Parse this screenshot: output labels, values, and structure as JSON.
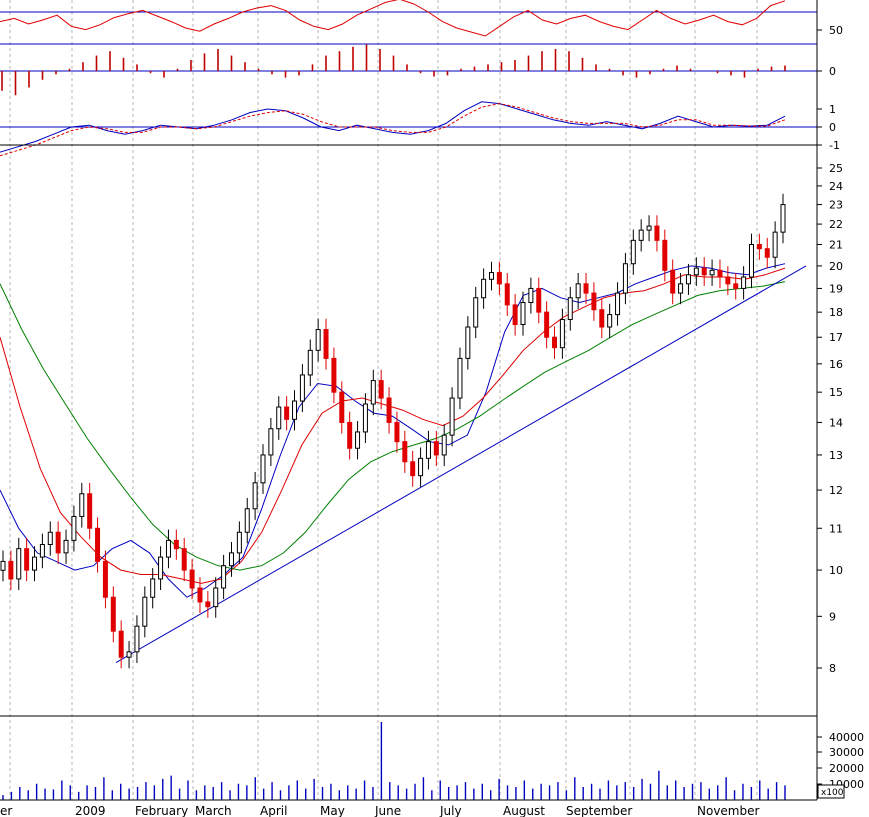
{
  "chart_data": [
    {
      "panel": "indicator-oscillator-top",
      "type": "line",
      "y_ticks": [
        "50"
      ],
      "series": [
        {
          "color": "#e00000",
          "values": [
            58,
            62,
            55,
            60,
            66,
            52,
            48,
            54,
            63,
            68,
            72,
            65,
            58,
            50,
            46,
            55,
            62,
            70,
            75,
            78,
            72,
            60,
            52,
            48,
            55,
            66,
            74,
            82,
            86,
            80,
            70,
            58,
            50,
            45,
            40,
            52,
            64,
            72,
            60,
            55,
            62,
            66,
            58,
            52,
            48,
            60,
            72,
            62,
            55,
            60,
            66,
            58,
            54,
            62,
            78,
            84
          ]
        }
      ],
      "reference_lines": [
        70,
        30
      ]
    },
    {
      "panel": "indicator-histogram",
      "type": "bar",
      "y_ticks": [
        "0"
      ],
      "series": [
        {
          "color": "#c00000",
          "values": [
            -18,
            -22,
            -15,
            -8,
            -3,
            2,
            8,
            14,
            18,
            12,
            6,
            -2,
            -6,
            2,
            10,
            16,
            20,
            14,
            8,
            2,
            -3,
            -6,
            -4,
            6,
            14,
            18,
            22,
            24,
            20,
            14,
            6,
            -2,
            -5,
            -4,
            2,
            4,
            6,
            8,
            10,
            14,
            18,
            20,
            18,
            12,
            6,
            2,
            -4,
            -6,
            -3,
            2,
            5,
            2,
            0,
            -2,
            -4,
            -6,
            2,
            4,
            5
          ]
        }
      ]
    },
    {
      "panel": "indicator-macd",
      "type": "line",
      "y_ticks": [
        "1",
        "0",
        "-1"
      ],
      "series": [
        {
          "color": "#0000c0",
          "values": [
            -1.4,
            -1.1,
            -0.8,
            -0.4,
            0.0,
            0.1,
            -0.2,
            -0.4,
            -0.2,
            0.1,
            0.0,
            -0.1,
            0.1,
            0.4,
            0.8,
            1.0,
            0.9,
            0.5,
            0.0,
            -0.2,
            0.1,
            -0.1,
            -0.3,
            -0.4,
            -0.2,
            0.2,
            0.9,
            1.4,
            1.3,
            1.0,
            0.7,
            0.4,
            0.2,
            0.1,
            0.3,
            0.1,
            -0.1,
            0.2,
            0.6,
            0.3,
            0.0,
            0.1,
            0.05,
            0.1,
            0.6
          ]
        },
        {
          "color": "#e00000",
          "dashed": true,
          "values": [
            -1.6,
            -1.3,
            -1.0,
            -0.6,
            -0.2,
            0.0,
            -0.1,
            -0.3,
            -0.3,
            0.0,
            0.0,
            -0.1,
            0.0,
            0.3,
            0.6,
            0.8,
            0.9,
            0.7,
            0.3,
            0.0,
            0.0,
            0.0,
            -0.2,
            -0.3,
            -0.3,
            0.0,
            0.6,
            1.1,
            1.3,
            1.1,
            0.8,
            0.5,
            0.3,
            0.2,
            0.2,
            0.2,
            0.0,
            0.1,
            0.4,
            0.4,
            0.1,
            0.1,
            0.05,
            0.05,
            0.4
          ]
        }
      ]
    },
    {
      "panel": "price",
      "type": "candlestick",
      "scale": "log",
      "y_ticks": [
        "25",
        "24",
        "23",
        "22",
        "21",
        "20",
        "19",
        "18",
        "17",
        "16",
        "15",
        "14",
        "13",
        "12",
        "11",
        "10",
        "9",
        "8"
      ],
      "x_labels": [
        "er",
        "2009",
        "February",
        "March",
        "April",
        "May",
        "June",
        "July",
        "August",
        "September",
        "November"
      ],
      "closes": [
        10.2,
        9.8,
        10.5,
        10.0,
        10.3,
        10.6,
        10.9,
        10.4,
        10.7,
        11.3,
        11.9,
        11.0,
        10.2,
        9.4,
        8.7,
        8.2,
        8.3,
        8.8,
        9.4,
        9.8,
        10.3,
        10.7,
        10.5,
        10.0,
        9.6,
        9.3,
        9.2,
        9.6,
        10.1,
        10.4,
        10.9,
        11.5,
        12.2,
        13.0,
        13.8,
        14.5,
        14.1,
        14.7,
        15.6,
        16.5,
        17.3,
        16.2,
        15.0,
        14.0,
        13.2,
        13.7,
        14.6,
        15.4,
        14.8,
        14.0,
        13.4,
        12.8,
        12.4,
        12.9,
        13.4,
        13.0,
        13.6,
        14.8,
        16.2,
        17.4,
        18.6,
        19.4,
        19.7,
        19.2,
        18.3,
        17.5,
        18.4,
        19.0,
        18.0,
        17.0,
        16.6,
        17.7,
        18.6,
        19.2,
        18.8,
        18.1,
        17.4,
        17.9,
        18.8,
        20.1,
        21.2,
        21.7,
        21.9,
        21.2,
        19.8,
        18.8,
        19.2,
        19.6,
        19.9,
        19.6,
        19.8,
        19.5,
        19.2,
        19.0,
        19.5,
        21.0,
        20.8,
        20.4,
        21.6,
        23.0
      ],
      "moving_averages": [
        {
          "color": "#0000c0",
          "values": [
            12.0,
            11.0,
            10.4,
            10.2,
            10.0,
            10.1,
            10.5,
            10.7,
            10.4,
            9.8,
            9.4,
            9.6,
            9.9,
            10.3,
            11.5,
            13.0,
            14.5,
            15.3,
            15.2,
            14.7,
            14.3,
            14.2,
            13.8,
            13.4,
            13.3,
            13.6,
            15.0,
            17.2,
            18.7,
            19.0,
            18.6,
            18.4,
            18.6,
            18.8,
            19.2,
            19.5,
            19.8,
            20.0,
            19.9,
            19.7,
            19.6,
            19.9,
            20.1
          ]
        },
        {
          "color": "#e00000",
          "values": [
            17.0,
            14.5,
            12.6,
            11.4,
            10.8,
            10.3,
            10.0,
            9.9,
            9.9,
            9.8,
            9.7,
            9.8,
            10.2,
            10.9,
            12.0,
            13.3,
            14.3,
            14.7,
            14.8,
            14.6,
            14.4,
            14.1,
            13.9,
            14.2,
            14.8,
            15.6,
            16.5,
            17.2,
            17.8,
            18.2,
            18.6,
            18.8,
            18.9,
            19.2,
            19.6,
            19.5,
            19.5,
            19.4,
            19.6,
            19.9
          ]
        },
        {
          "color": "#008000",
          "values": [
            19.2,
            17.3,
            15.8,
            14.6,
            13.5,
            12.6,
            11.8,
            11.1,
            10.6,
            10.3,
            10.1,
            10.0,
            10.1,
            10.4,
            10.9,
            11.6,
            12.3,
            12.8,
            13.1,
            13.3,
            13.5,
            13.8,
            14.2,
            14.7,
            15.2,
            15.7,
            16.1,
            16.5,
            17.0,
            17.5,
            17.9,
            18.3,
            18.7,
            18.9,
            19.0,
            19.1,
            19.3
          ]
        }
      ],
      "trendline": {
        "color": "#0000c0",
        "from": 8.1,
        "to": 20.0
      }
    },
    {
      "panel": "volume",
      "type": "bar",
      "y_ticks": [
        "40000",
        "30000",
        "20000",
        "10000"
      ],
      "y_unit": "x100",
      "color": "#0000c0",
      "max_value": 48000,
      "series": [
        {
          "values": [
            3000,
            5000,
            8000,
            6000,
            10000,
            7000,
            6500,
            12000,
            9000,
            5000,
            9000,
            8000,
            14000,
            6000,
            10000,
            7000,
            8000,
            11000,
            9000,
            13000,
            15000,
            7000,
            12000,
            6000,
            9000,
            8000,
            11000,
            6000,
            10000,
            9000,
            14000,
            7000,
            11000,
            6000,
            9000,
            12000,
            7000,
            13000,
            8000,
            10000,
            6000,
            9000,
            7000,
            12000,
            8000,
            48000,
            11000,
            9000,
            7000,
            10000,
            14000,
            6000,
            12000,
            8000,
            9000,
            11000,
            7000,
            10000,
            6000,
            13000,
            9000,
            8000,
            12000,
            7000,
            10000,
            9000,
            11000,
            6000,
            14000,
            8000,
            10000,
            7000,
            12000,
            9000,
            11000,
            8000,
            13000,
            10000,
            18000,
            9000,
            12000,
            8000,
            10000,
            11000,
            7000,
            9000,
            14000,
            6000,
            10000,
            8000,
            12000,
            7000,
            11000,
            9000
          ]
        }
      ]
    }
  ]
}
